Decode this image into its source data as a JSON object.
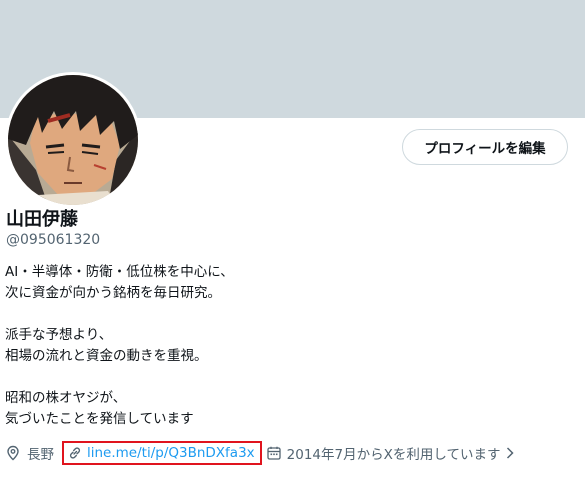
{
  "profile": {
    "name": "山田伊藤",
    "handle": "@095061320",
    "edit_button_label": "プロフィールを編集",
    "bio_lines": [
      "AI・半導体・防衛・低位株を中心に、",
      "次に資金が向かう銘柄を毎日研究。",
      "",
      "派手な予想より、",
      "相場の流れと資金の動きを重視。",
      "",
      "昭和の株オヤジが、",
      "気づいたことを発信しています"
    ],
    "location": "長野",
    "link": "line.me/ti/p/Q3BnDXfa3x",
    "joined": "2014年7月からXを利用しています"
  },
  "icons": {
    "location": "location-pin-icon",
    "link": "link-icon",
    "joined": "calendar-icon",
    "chevron": "chevron-right-icon"
  },
  "colors": {
    "banner": "#cfd9de",
    "link": "#1d9bf0",
    "secondary_text": "#536471",
    "highlight_box": "#e0141e"
  }
}
